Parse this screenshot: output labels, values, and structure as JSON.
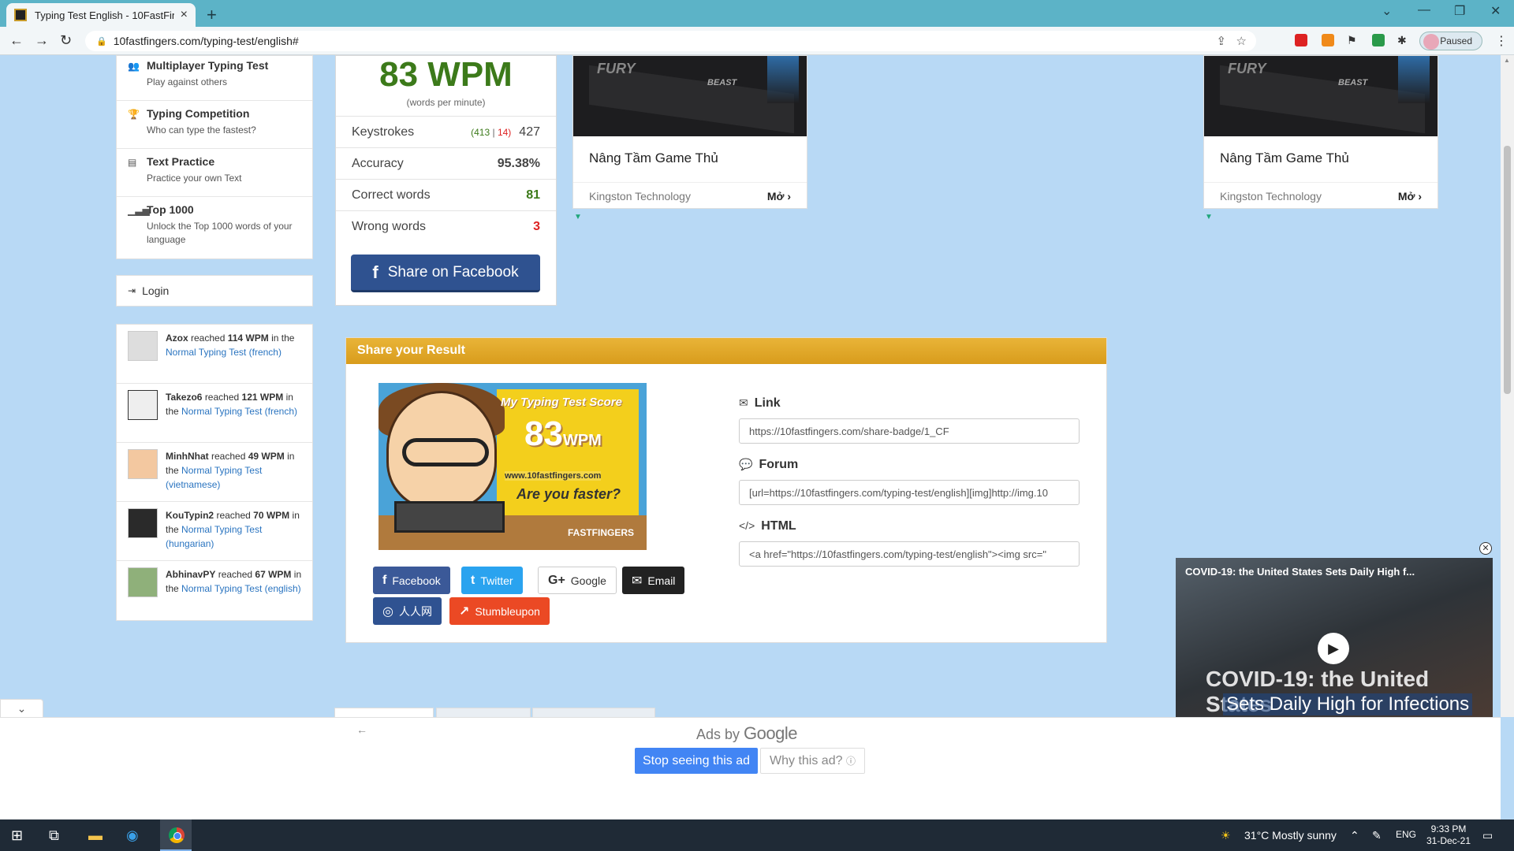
{
  "browser": {
    "tab_title": "Typing Test English - 10FastFingers",
    "url": "10fastfingers.com/typing-test/english#",
    "profile_label": "Paused"
  },
  "sidebar": {
    "items": [
      {
        "title": "Multiplayer Typing Test",
        "subtitle": "Play against others",
        "icon": "group-icon"
      },
      {
        "title": "Typing Competition",
        "subtitle": "Who can type the fastest?",
        "icon": "trophy-icon"
      },
      {
        "title": "Text Practice",
        "subtitle": "Practice your own Text",
        "icon": "document-icon"
      },
      {
        "title": "Top 1000",
        "subtitle": "Unlock the Top 1000 words of your language",
        "icon": "signal-icon"
      }
    ],
    "login_label": "Login"
  },
  "feed": [
    {
      "user": "Azox",
      "reached": "reached",
      "wpm": "114 WPM",
      "in": "in the",
      "test": "Normal Typing Test",
      "lang": "(french)"
    },
    {
      "user": "Takezo6",
      "reached": "reached",
      "wpm": "121 WPM",
      "in": "in the",
      "test": "Normal Typing Test",
      "lang": "(french)"
    },
    {
      "user": "MinhNhat",
      "reached": "reached",
      "wpm": "49 WPM",
      "in": "in the",
      "test": "Normal Typing Test",
      "lang": "(vietnamese)"
    },
    {
      "user": "KouTypin2",
      "reached": "reached",
      "wpm": "70 WPM",
      "in": "in the",
      "test": "Normal Typing Test",
      "lang": "(hungarian)"
    },
    {
      "user": "AbhinavPY",
      "reached": "reached",
      "wpm": "67 WPM",
      "in": "in the",
      "test": "Normal Typing Test",
      "lang": "(english)"
    }
  ],
  "results": {
    "wpm": "83 WPM",
    "wpm_sub": "(words per minute)",
    "keystrokes_label": "Keystrokes",
    "keystrokes_correct": "413",
    "keystrokes_sep": "|",
    "keystrokes_wrong": "14",
    "keystrokes_total": "427",
    "accuracy_label": "Accuracy",
    "accuracy_value": "95.38%",
    "correct_label": "Correct words",
    "correct_value": "81",
    "wrong_label": "Wrong words",
    "wrong_value": "3",
    "share_fb_label": "Share on Facebook"
  },
  "ads": [
    {
      "brand": "FURY",
      "model": "BEAST",
      "headline": "Nâng Tầm Game Thủ",
      "advertiser": "Kingston Technology",
      "open_label": "Mở"
    },
    {
      "brand": "FURY",
      "model": "BEAST",
      "headline": "Nâng Tầm Game Thủ",
      "advertiser": "Kingston Technology",
      "open_label": "Mở"
    }
  ],
  "share": {
    "header": "Share your Result",
    "badge": {
      "title": "My Typing Test Score",
      "score": "83",
      "unit": "WPM",
      "site": "www.10fastfingers.com",
      "question": "Are you faster?",
      "logo": "FASTFINGERS"
    },
    "buttons": [
      {
        "label": "Facebook",
        "glyph": "f",
        "color": "#3b5998"
      },
      {
        "label": "Twitter",
        "glyph": "t",
        "color": "#2aa3ef"
      },
      {
        "label": "Google",
        "glyph": "G+",
        "color": "#ffffff"
      },
      {
        "label": "Email",
        "glyph": "✉",
        "color": "#222222"
      },
      {
        "label": "人人网",
        "glyph": "◎",
        "color": "#2f5291"
      },
      {
        "label": "Stumbleupon",
        "glyph": "↗",
        "color": "#eb4924"
      }
    ],
    "link_label": "Link",
    "link_value": "https://10fastfingers.com/share-badge/1_CF",
    "forum_label": "Forum",
    "forum_value": "[url=https://10fastfingers.com/typing-test/english][img]http://img.10",
    "html_label": "HTML",
    "html_value": "<a href=\"https://10fastfingers.com/typing-test/english\"><img src=\""
  },
  "bottom_ad": {
    "ads_by": "Ads by",
    "google": "Google",
    "stop_label": "Stop seeing this ad",
    "why_label": "Why this ad?"
  },
  "video": {
    "title": "COVID-19: the United States Sets Daily High f...",
    "caption1": "COVID-19: the United States",
    "caption2": "Sets Daily High for Infections"
  },
  "taskbar": {
    "weather": "31°C  Mostly sunny",
    "lang": "ENG",
    "time": "9:33 PM",
    "date": "31-Dec-21"
  }
}
